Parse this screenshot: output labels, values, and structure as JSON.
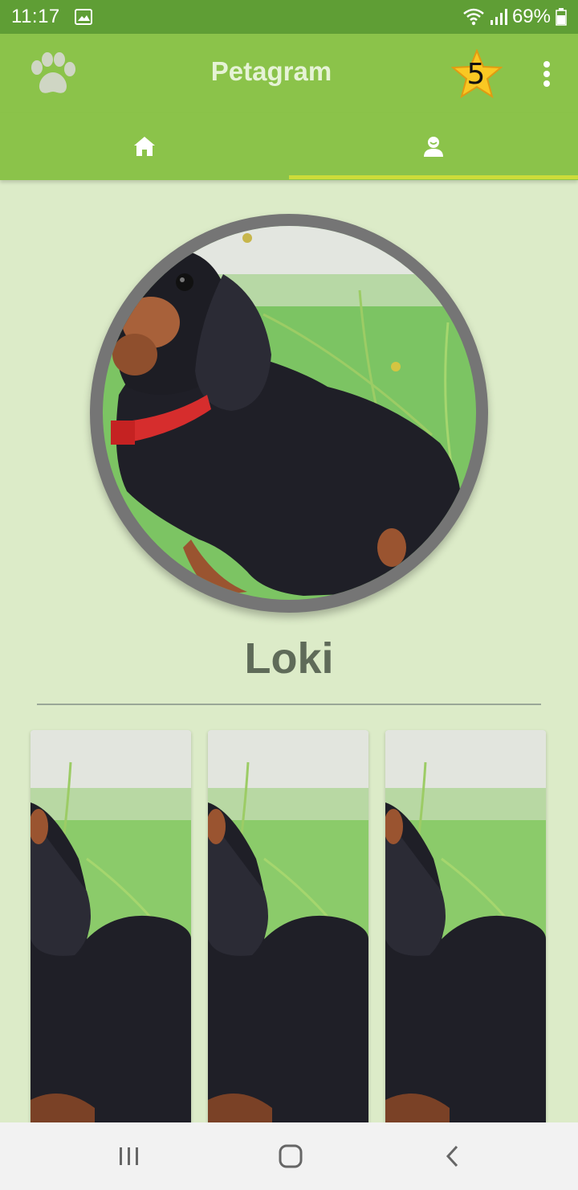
{
  "status_bar": {
    "time": "11:17",
    "battery": "69%",
    "icons": [
      "gallery-icon",
      "wifi-icon",
      "signal-icon",
      "battery-icon"
    ]
  },
  "app_bar": {
    "title": "Petagram",
    "rating_count": "5",
    "icons": [
      "paw-icon",
      "star-icon",
      "overflow-menu-icon"
    ]
  },
  "tabs": [
    {
      "icon": "home-icon",
      "selected": false
    },
    {
      "icon": "profile-icon",
      "selected": true
    }
  ],
  "profile": {
    "name": "Loki"
  },
  "gallery": {
    "items": [
      "dog-photo",
      "dog-photo",
      "dog-photo"
    ]
  },
  "nav_bar": {
    "icons": [
      "recent-apps-icon",
      "home-button-icon",
      "back-icon"
    ]
  },
  "colors": {
    "status_bar": "#5f9e35",
    "app_bar": "#8bc34a",
    "background": "#dcebc8",
    "tab_indicator": "#cddc39",
    "name_text": "#5f6b59"
  }
}
